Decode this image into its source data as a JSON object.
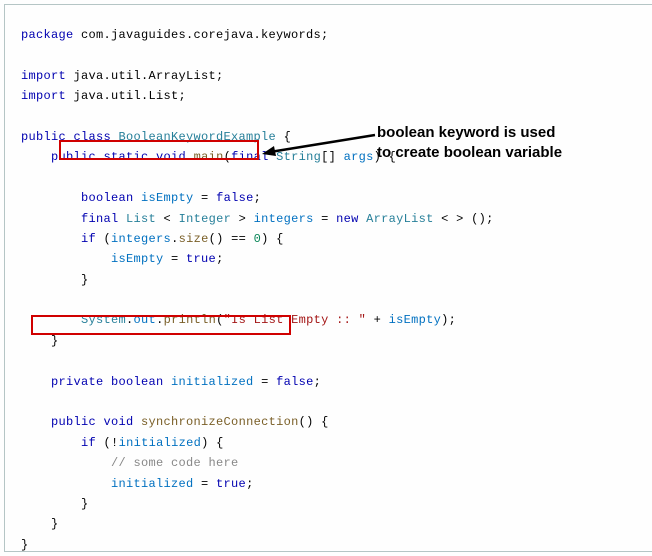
{
  "code": {
    "package_kw": "package",
    "package_name": " com.javaguides.corejava.keywords;",
    "import_kw1": "import",
    "import_name1": " java.util.ArrayList;",
    "import_kw2": "import",
    "import_name2": " java.util.List;",
    "public_kw": "public",
    "class_kw": " class",
    "class_name": " BooleanKeywordExample",
    "brace_open": " {",
    "public2": "public",
    "static_kw": " static",
    "void_kw": " void",
    "main": " main",
    "paren_open": "(",
    "final_kw": "final",
    "string_type": " String",
    "brackets": "[]",
    "args": " args",
    "paren_close_brace": ") {",
    "boolean_kw": "boolean",
    "isEmpty_var": " isEmpty",
    "eq": " =",
    "false_lit": " false",
    "semi": ";",
    "final2": "final",
    "list_type": " List",
    "lt": " <",
    "integer_type": " Integer",
    "gt": " >",
    "integers_var": " integers",
    "eq2": " =",
    "new_kw": " new",
    "arraylist_type": " ArrayList",
    "diamond": " < > ();",
    "if_kw": "if",
    "if_cond_open": " (",
    "integers_var2": "integers",
    "dot": ".",
    "size_mth": "size",
    "parens": "()",
    "eqeq": " ==",
    "zero": " 0",
    "if_close": ") {",
    "isEmpty_var2": "isEmpty",
    "eq3": " =",
    "true_lit": " true",
    "semi2": ";",
    "brace_close": "}",
    "system_var": "System",
    "out_var": "out",
    "println_mth": "println",
    "println_open": "(",
    "str_lit": "\"Is List Empty :: \"",
    "plus": " +",
    "isEmpty_var3": " isEmpty",
    "println_close": ");",
    "brace_close2": "}",
    "private_kw": "private",
    "boolean_kw2": " boolean",
    "initialized_var": " initialized",
    "eq4": " =",
    "false_lit2": " false",
    "semi3": ";",
    "public3": "public",
    "void2": " void",
    "sync_mth": " synchronizeConnection",
    "parens2": "()",
    "brace_open2": " {",
    "if_kw2": "if",
    "if_open2": " (",
    "bang": "!",
    "initialized_var2": "initialized",
    "if_close2": ") {",
    "comment": "// some code here",
    "initialized_var3": "initialized",
    "eq5": " =",
    "true_lit2": " true",
    "semi4": ";",
    "brace_close3": "}",
    "brace_close4": "}",
    "brace_close5": "}"
  },
  "annotation": {
    "line1": "boolean keyword is used",
    "line2": "to create boolean variable"
  }
}
